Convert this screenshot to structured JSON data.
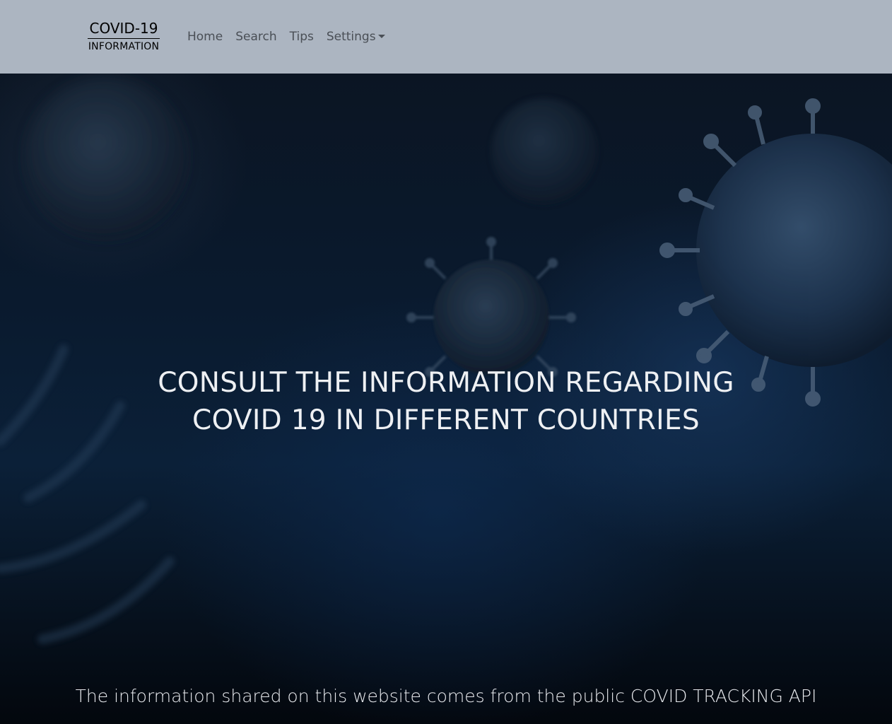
{
  "navbar": {
    "brand_title": "COVID-19",
    "brand_subtitle": "INFORMATION",
    "links": [
      {
        "label": "Home"
      },
      {
        "label": "Search"
      },
      {
        "label": "Tips"
      },
      {
        "label": "Settings"
      }
    ],
    "background": "#acb5c1"
  },
  "hero": {
    "title_line1": "CONSULT THE INFORMATION REGARDING",
    "title_line2": "COVID 19 IN DIFFERENT COUNTRIES",
    "footer_text": "The information shared on this website comes from the public COVID TRACKING API",
    "background_image": "coronavirus-particles-icon"
  }
}
